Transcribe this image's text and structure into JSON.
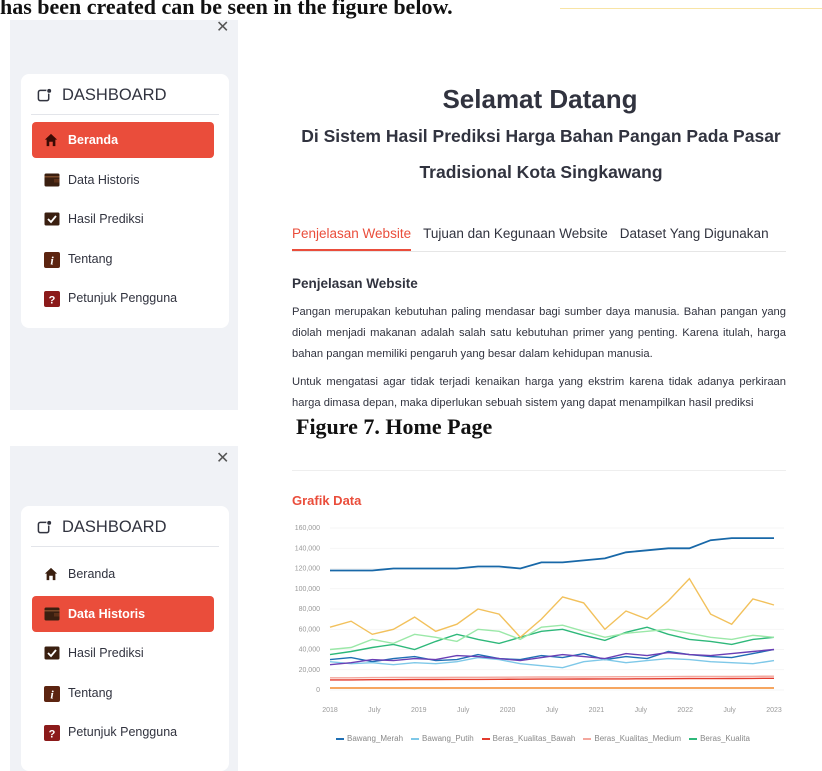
{
  "caption_top": "has been created can be seen in the figure below.",
  "sidebar_close_icon": "close-icon",
  "sidebar_header": "DASHBOARD",
  "nav_items": [
    {
      "label": "Beranda",
      "icon": "home-icon"
    },
    {
      "label": "Data Historis",
      "icon": "wallet-icon"
    },
    {
      "label": "Hasil Prediksi",
      "icon": "check-box-icon"
    },
    {
      "label": "Tentang",
      "icon": "info-icon"
    },
    {
      "label": "Petunjuk Pengguna",
      "icon": "question-icon"
    }
  ],
  "home": {
    "title": "Selamat Datang",
    "subtitle_line1": "Di Sistem Hasil Prediksi Harga Bahan Pangan Pada Pasar",
    "subtitle_line2": "Tradisional Kota Singkawang",
    "tabs": [
      "Penjelasan Website",
      "Tujuan dan Kegunaan Website",
      "Dataset Yang Digunakan"
    ],
    "section_heading": "Penjelasan Website",
    "para1": "Pangan merupakan kebutuhan paling mendasar bagi sumber daya manusia. Bahan pangan yang diolah menjadi makanan adalah salah satu kebutuhan primer yang penting. Karena itulah, harga bahan pangan memiliki pengaruh yang besar dalam kehidupan manusia.",
    "para2": "Untuk mengatasi agar tidak terjadi kenaikan harga yang ekstrim karena tidak adanya perkiraan harga dimasa depan, maka diperlukan sebuah sistem yang dapat menampilkan hasil prediksi"
  },
  "figure_caption": "Figure 7. Home Page",
  "grafik_title": "Grafik Data",
  "colors": {
    "accent": "#ea4d3b",
    "sidebar_bg": "#f0f2f6"
  },
  "chart_data": {
    "type": "line",
    "x_ticks": [
      "2018",
      "July",
      "2019",
      "July",
      "2020",
      "July",
      "2021",
      "July",
      "2022",
      "July",
      "2023"
    ],
    "y_ticks": [
      "160,000",
      "140,000",
      "120,000",
      "100,000",
      "80,000",
      "60,000",
      "40,000",
      "20,000",
      "0"
    ],
    "ylim": [
      0,
      160000
    ],
    "legend": "bottom",
    "series": [
      {
        "name": "Bawang_Merah",
        "color": "#1f6fb4",
        "values": [
          30000,
          32000,
          28000,
          31000,
          33000,
          29000,
          30000,
          35000,
          31000,
          30000,
          34000,
          32000,
          36000,
          30000,
          33000,
          31000,
          38000,
          35000,
          33000,
          32000,
          36000,
          40000
        ]
      },
      {
        "name": "Bawang_Putih",
        "color": "#7ec8e8",
        "values": [
          28000,
          26000,
          27000,
          25000,
          27000,
          26000,
          28000,
          32000,
          30000,
          26000,
          24000,
          22000,
          28000,
          30000,
          27000,
          29000,
          31000,
          30000,
          28000,
          27000,
          26000,
          29000
        ]
      },
      {
        "name": "Beras_Kualitas_Bawah",
        "color": "#e33b2e",
        "values": [
          10000,
          10000,
          10200,
          10200,
          10300,
          10400,
          10500,
          10500,
          10600,
          10700,
          10800,
          10800,
          10900,
          11000,
          11000,
          11100,
          11200,
          11300,
          11300,
          11400,
          11500,
          11600
        ]
      },
      {
        "name": "Beras_Kualitas_Medium",
        "color": "#f4a79e",
        "values": [
          12000,
          12000,
          12200,
          12300,
          12300,
          12400,
          12500,
          12500,
          12600,
          12700,
          12800,
          12800,
          12900,
          13000,
          13100,
          13100,
          13200,
          13300,
          13400,
          13400,
          13500,
          13600
        ]
      },
      {
        "name": "Beras_Kualita",
        "color": "#2eb87a",
        "values": [
          35000,
          38000,
          42000,
          45000,
          40000,
          48000,
          55000,
          50000,
          46000,
          52000,
          58000,
          60000,
          54000,
          49000,
          57000,
          62000,
          55000,
          50000,
          48000,
          45000,
          50000,
          52000
        ]
      },
      {
        "name": "",
        "color": "#f2c15c",
        "values": [
          62000,
          68000,
          55000,
          60000,
          72000,
          58000,
          65000,
          80000,
          75000,
          52000,
          70000,
          92000,
          86000,
          60000,
          78000,
          70000,
          88000,
          110000,
          75000,
          65000,
          90000,
          84000
        ]
      },
      {
        "name": "",
        "color": "#1868a8",
        "values": [
          118000,
          118000,
          118000,
          120000,
          120000,
          120000,
          120000,
          122000,
          122000,
          120000,
          126000,
          126000,
          128000,
          130000,
          136000,
          138000,
          140000,
          140000,
          148000,
          150000,
          150000,
          150000
        ]
      },
      {
        "name": "",
        "color": "#6a3fb5",
        "values": [
          25000,
          27000,
          30000,
          29000,
          31000,
          30000,
          34000,
          33000,
          31000,
          29000,
          32000,
          35000,
          33000,
          31000,
          36000,
          34000,
          37000,
          35000,
          34000,
          36000,
          38000,
          40000
        ]
      },
      {
        "name": "",
        "color": "#9be8a8",
        "values": [
          40000,
          42000,
          50000,
          46000,
          55000,
          52000,
          48000,
          60000,
          58000,
          50000,
          62000,
          64000,
          58000,
          52000,
          56000,
          58000,
          60000,
          56000,
          52000,
          50000,
          54000,
          52000
        ]
      },
      {
        "name": "",
        "color": "#f4892c",
        "values": [
          2000,
          2000,
          2000,
          2000,
          2000,
          2000,
          2000,
          2000,
          2000,
          2000,
          2000,
          2000,
          2000,
          2000,
          2000,
          2000,
          2000,
          2000,
          2000,
          2000,
          2000,
          2000
        ]
      }
    ]
  }
}
